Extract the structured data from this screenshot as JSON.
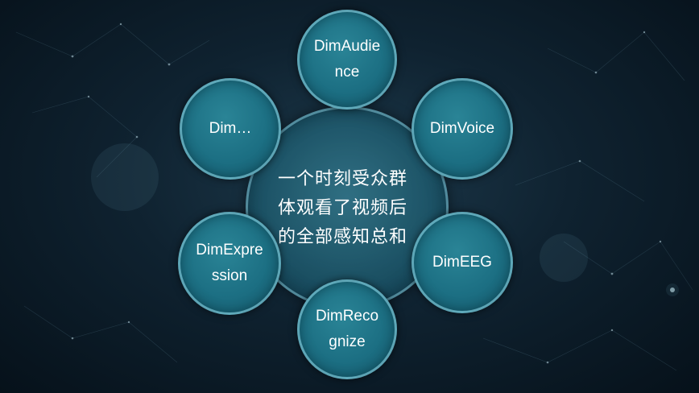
{
  "center": {
    "text": "一个时刻受众群体观看了视频后的全部感知总和"
  },
  "nodes": {
    "top": "DimAudience",
    "top_right": "DimVoice",
    "bottom_right": "DimEEG",
    "bottom": "DimRecognize",
    "bottom_left": "DimExpression",
    "top_left": "Dim…"
  },
  "colors": {
    "background": "#0f2230",
    "node_fill": "#1c6f83",
    "node_border": "#96d7e6",
    "text": "#ffffff"
  }
}
